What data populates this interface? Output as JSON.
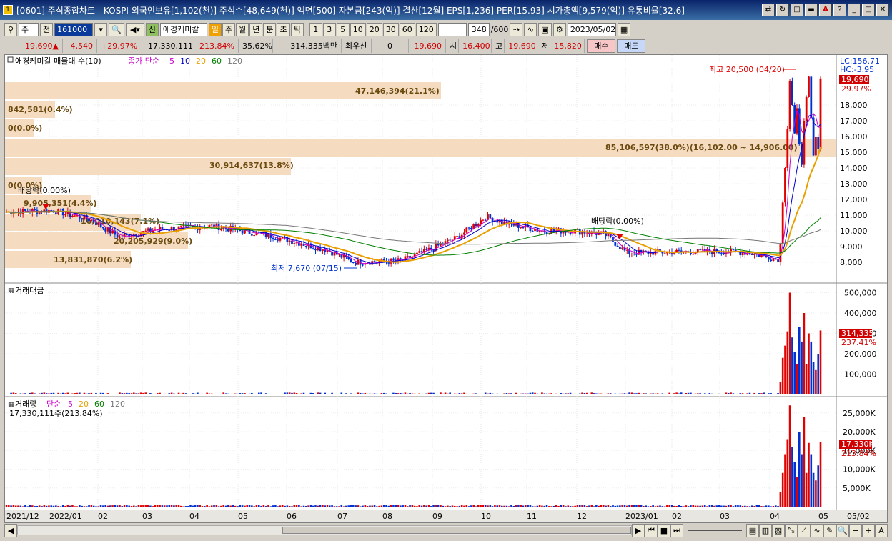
{
  "title": "[0601] 주식종합차트 - KOSPI 외국인보유[1,102(천)] 주식수[48,649(천)] 액면[500] 자본금[243(억)] 결산[12월] EPS[1,236] PER[15.93] 시가총액[9,579(억)] 유통비율[32.6]",
  "toolbar": {
    "type_sel": "주",
    "prev_label": "전",
    "code_value": "161000",
    "stock_name": "애경케미칼",
    "period_buttons": [
      "일",
      "주",
      "월",
      "년",
      "분",
      "초",
      "틱"
    ],
    "active_period": "일",
    "num_buttons": [
      "1",
      "3",
      "5",
      "10",
      "20",
      "30",
      "60",
      "120"
    ],
    "count_value": "348",
    "count_total": "/600",
    "date_value": "2023/05/02"
  },
  "quote": {
    "price": "19,690",
    "arrow": "▲",
    "change": "4,540",
    "change_pct": "+29.97%",
    "volume": "17,330,111",
    "vol_pct": "213.84%",
    "turn": "35.62%",
    "amount": "314,335백만",
    "prior_label": "최우선",
    "prior_value": "0",
    "ask": "19,690",
    "open_label": "시",
    "open": "16,400",
    "high_label": "고",
    "high": "19,690",
    "low_label": "저",
    "low": "15,820",
    "buy_label": "매수",
    "sell_label": "매도"
  },
  "price_panel": {
    "legend_name": "애경케미칼 매물대 수(10)",
    "legend_ma_label": "종가 단순",
    "legend_ma": [
      "5",
      "10",
      "20",
      "60",
      "120"
    ],
    "legend_ma_colors": [
      "#cc00cc",
      "#0000cc",
      "#e8a000",
      "#008000",
      "#777777"
    ],
    "lc": "LC:156.71",
    "hc": "HC:-3.95",
    "current_price": "19,690",
    "current_pct": "29.97%",
    "high_note": "최고 20,500 (04/20)",
    "low_note": "최저 7,670 (07/15)",
    "div_note1": "배당락(0.00%)",
    "div_note2": "배당락(0.00%)",
    "vp_labels": [
      "47,146,394(21.1%)",
      "842,581(0.4%)",
      "0(0.0%)",
      "85,106,597(38.0%)(16,102.00 ~ 14,906.00)",
      "30,914,637(13.8%)",
      "0(0.0%)",
      "9,905,351(4.4%)",
      "16,010,143(7.1%)",
      "20,205,929(9.0%)",
      "13,831,870(6.2%)"
    ],
    "y_ticks": [
      "18,000",
      "17,000",
      "16,000",
      "15,000",
      "14,000",
      "13,000",
      "12,000",
      "11,000",
      "10,000",
      "9,000",
      "8,000"
    ]
  },
  "amount_panel": {
    "legend": "거래대금",
    "current": "314,335",
    "current_pct": "237.41%",
    "y_ticks": [
      "500,000",
      "400,000",
      "300,000",
      "200,000",
      "100,000"
    ]
  },
  "volume_panel": {
    "legend": "거래량",
    "legend_ma_label": "단순",
    "legend_ma": [
      "5",
      "20",
      "60",
      "120"
    ],
    "sub": "17,330,111주(213.84%)",
    "current": "17,330K",
    "current_pct": "213.84%",
    "y_ticks": [
      "25,000K",
      "20,000K",
      "15,000K",
      "10,000K",
      "5,000K"
    ]
  },
  "x_labels": [
    "2021/12",
    "2022/01",
    "02",
    "03",
    "04",
    "05",
    "06",
    "07",
    "08",
    "09",
    "10",
    "11",
    "12",
    "2023/01",
    "02",
    "03",
    "04",
    "05",
    "05/02"
  ],
  "colors": {
    "up": "#e00000",
    "down": "#0030d0",
    "ma5": "#cc00cc",
    "ma10": "#0000cc",
    "ma20": "#e8a000",
    "ma60": "#008000",
    "ma120": "#777777",
    "vp": "#f5dcc0"
  }
}
